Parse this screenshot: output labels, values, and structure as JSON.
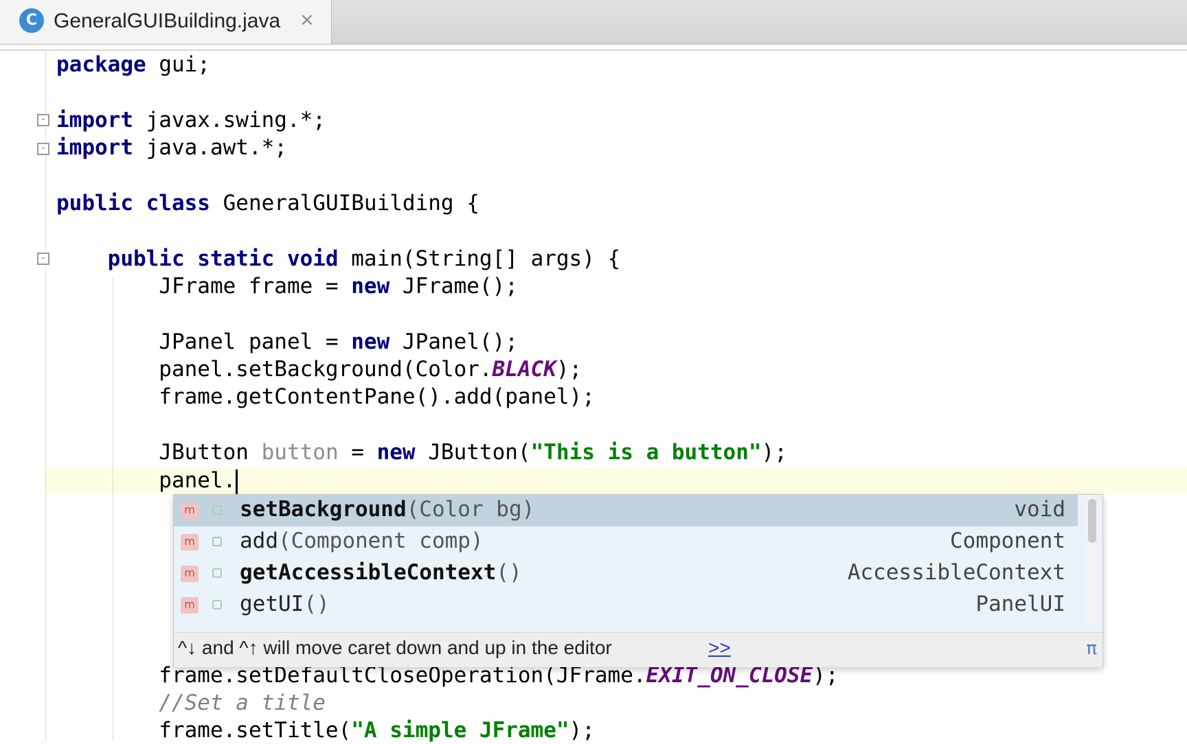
{
  "tab": {
    "title": "GeneralGUIBuilding.java",
    "icon_letter": "C",
    "close": "×"
  },
  "code_lines": [
    "package gui;",
    "import javax.swing.*;",
    "import java.awt.*;",
    "public class GeneralGUIBuilding {",
    "public static void main(String[] args) {",
    "JFrame frame = new JFrame();",
    "JPanel panel = new JPanel();",
    "panel.setBackground(Color.BLACK);",
    "frame.getContentPane().add(panel);",
    "JButton button = new JButton(\"This is a button\");",
    "panel.",
    "frame.setDefaultCloseOperation(JFrame.EXIT_ON_CLOSE);",
    "//Set a title",
    "frame.setTitle(\"A simple JFrame\");"
  ],
  "completion": {
    "items": [
      {
        "name": "setBackground",
        "params": "(Color bg)",
        "type": "void",
        "icon": "m"
      },
      {
        "name": "add",
        "params": "(Component comp)",
        "type": "Component",
        "icon": "m"
      },
      {
        "name": "getAccessibleContext",
        "params": "()",
        "type": "AccessibleContext",
        "icon": "m"
      },
      {
        "name": "getUI",
        "params": "()",
        "type": "PanelUI",
        "icon": "m"
      }
    ],
    "hint": "^↓ and ^↑ will move caret down and up in the editor",
    "hint_link": ">>",
    "pi": "π"
  },
  "colors": {
    "keyword": "#000080",
    "string": "#008000",
    "constant": "#660e7a",
    "caret_line": "#fdfde3"
  }
}
